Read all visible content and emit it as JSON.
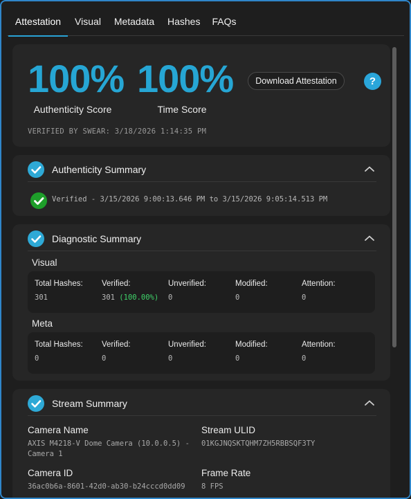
{
  "tabs": [
    "Attestation",
    "Visual",
    "Metadata",
    "Hashes",
    "FAQs"
  ],
  "scores": {
    "authenticity_value": "100%",
    "authenticity_label": "Authenticity Score",
    "time_value": "100%",
    "time_label": "Time Score",
    "download_label": "Download Attestation",
    "help_glyph": "?",
    "verified_by": "VERIFIED BY SWEAR: 3/18/2026 1:14:35 PM"
  },
  "authenticity_summary": {
    "title": "Authenticity Summary",
    "verified_text": "Verified - 3/15/2026 9:00:13.646 PM to 3/15/2026 9:05:14.513 PM"
  },
  "diagnostic_summary": {
    "title": "Diagnostic Summary",
    "visual": {
      "title": "Visual",
      "labels": [
        "Total Hashes:",
        "Verified:",
        "Unverified:",
        "Modified:",
        "Attention:"
      ],
      "total": "301",
      "verified": "301",
      "verified_pct": "(100.00%)",
      "unverified": "0",
      "modified": "0",
      "attention": "0"
    },
    "meta": {
      "title": "Meta",
      "labels": [
        "Total Hashes:",
        "Verified:",
        "Unverified:",
        "Modified:",
        "Attention:"
      ],
      "total": "0",
      "verified": "0",
      "unverified": "0",
      "modified": "0",
      "attention": "0"
    }
  },
  "stream_summary": {
    "title": "Stream Summary",
    "camera_name_label": "Camera Name",
    "camera_name_line1": "AXIS M4218-V Dome Camera (10.0.0.5) -",
    "camera_name_line2": "Camera 1",
    "stream_ulid_label": "Stream ULID",
    "stream_ulid": "01KGJNQSKTQHM7ZH5RBBSQF3TY",
    "camera_id_label": "Camera ID",
    "camera_id": "36ac0b6a-8601-42d0-ab30-b24cccd0dd09",
    "frame_rate_label": "Frame Rate",
    "frame_rate": "8 FPS"
  },
  "colors": {
    "accent": "#26a6d4",
    "border": "#2f86c9",
    "success": "#1e9e2a",
    "percent_green": "#3fd46a"
  },
  "icons": [
    "check-circle-icon",
    "verified-check-icon",
    "chevron-up-icon",
    "help-icon"
  ]
}
